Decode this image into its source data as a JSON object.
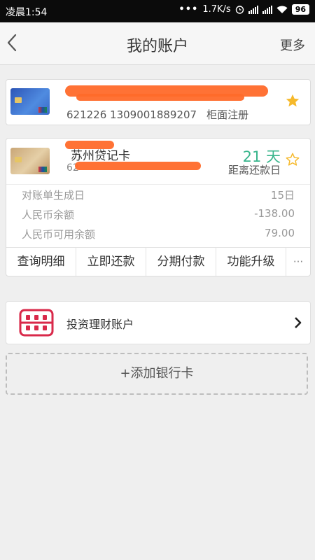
{
  "status_bar": {
    "time": "凌晨1:54",
    "more_dots": "•••",
    "net_speed": "1.7K/s",
    "battery": "96"
  },
  "header": {
    "title": "我的账户",
    "more": "更多"
  },
  "card1": {
    "number": "621226 1309001889207",
    "registration": "柜面注册",
    "starred": true
  },
  "card2": {
    "name": "苏州贷记卡",
    "number_prefix": "62",
    "days_value": "21 天",
    "days_label": "距离还款日",
    "starred": false,
    "rows": [
      {
        "label": "对账单生成日",
        "value": "15日"
      },
      {
        "label": "人民币余额",
        "value": "-138.00"
      },
      {
        "label": "人民币可用余额",
        "value": "79.00"
      }
    ],
    "actions": [
      "查询明细",
      "立即还款",
      "分期付款",
      "功能升级",
      "···"
    ]
  },
  "invest": {
    "label": "投资理财账户"
  },
  "add_card": {
    "label": "+添加银行卡"
  },
  "colors": {
    "accent_green": "#39b58c",
    "star_gold": "#f6b92b",
    "abacus_red": "#d9294a",
    "redaction": "#ff6a2a"
  }
}
